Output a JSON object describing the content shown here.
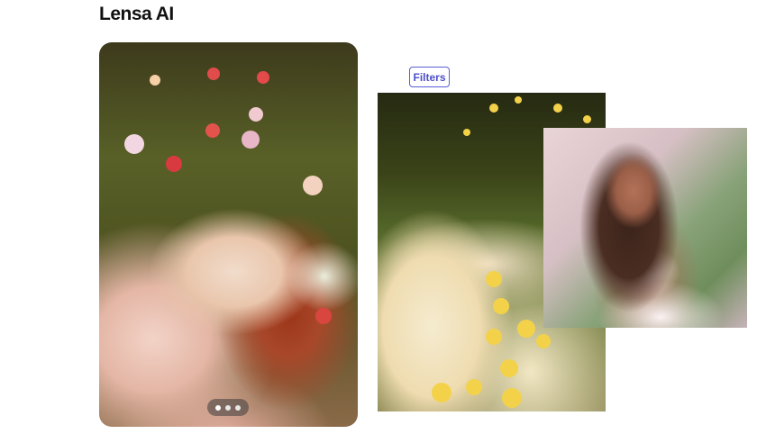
{
  "app": {
    "title": "Lensa AI"
  },
  "toolbar": {
    "filters_label": "Filters"
  },
  "carousel": {
    "slide_count": 3,
    "active_index": 0
  },
  "colors": {
    "accent": "#4c4fc9",
    "accent_border": "#5b5fd6"
  },
  "icons": {
    "carousel_dot": "dot-icon"
  }
}
